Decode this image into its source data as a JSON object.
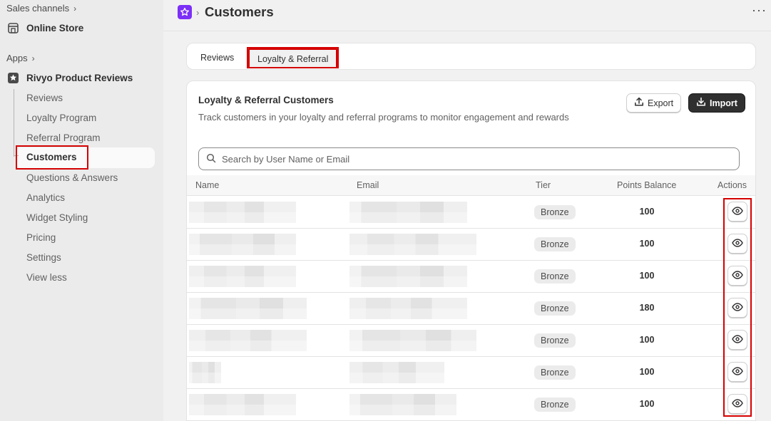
{
  "sidebar": {
    "sales_channels_label": "Sales channels",
    "online_store_label": "Online Store",
    "apps_label": "Apps",
    "app_name": "Rivyo Product Reviews",
    "items": [
      {
        "label": "Reviews"
      },
      {
        "label": "Loyalty Program"
      },
      {
        "label": "Referral Program"
      },
      {
        "label": "Customers"
      },
      {
        "label": "Questions & Answers"
      },
      {
        "label": "Analytics"
      },
      {
        "label": "Widget Styling"
      },
      {
        "label": "Pricing"
      },
      {
        "label": "Settings"
      },
      {
        "label": "View less"
      }
    ],
    "active_item": "Customers"
  },
  "header": {
    "breadcrumb_sep": "›",
    "title": "Customers",
    "more_label": "···"
  },
  "tabs": [
    {
      "label": "Reviews",
      "active": false
    },
    {
      "label": "Loyalty & Referral",
      "active": true
    }
  ],
  "card": {
    "title": "Loyalty & Referral Customers",
    "subtitle": "Track customers in your loyalty and referral programs to monitor engagement and rewards",
    "export_label": "Export",
    "import_label": "Import",
    "search_placeholder": "Search by User Name or Email"
  },
  "table": {
    "columns": [
      "Name",
      "Email",
      "Tier",
      "Points Balance",
      "Actions"
    ],
    "rows": [
      {
        "tier": "Bronze",
        "points": "100"
      },
      {
        "tier": "Bronze",
        "points": "100"
      },
      {
        "tier": "Bronze",
        "points": "100"
      },
      {
        "tier": "Bronze",
        "points": "180"
      },
      {
        "tier": "Bronze",
        "points": "100"
      },
      {
        "tier": "Bronze",
        "points": "100"
      },
      {
        "tier": "Bronze",
        "points": "100"
      }
    ]
  },
  "colors": {
    "accent_app": "#7b2ff7",
    "highlight": "#d50000",
    "primary_button": "#303030"
  },
  "icons": [
    "chevron-right-icon",
    "store-icon",
    "star-badge-icon",
    "search-icon",
    "upload-icon",
    "download-icon",
    "eye-icon",
    "more-icon"
  ]
}
